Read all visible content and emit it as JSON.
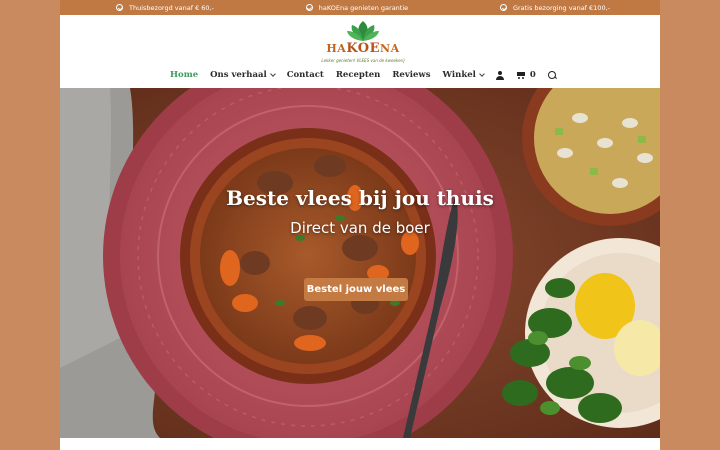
{
  "topbar": {
    "items": [
      {
        "icon": "check-circle-icon",
        "label": "Thuisbezorgd vanaf € 60,-"
      },
      {
        "icon": "check-circle-icon",
        "label": "haKOEna genieten garantie"
      },
      {
        "icon": "check-circle-icon",
        "label": "Gratis bezorging vanaf €100,-"
      }
    ]
  },
  "logo": {
    "prefix": "HA",
    "middle": "KOE",
    "suffix": "NA",
    "tagline": "Lekker genieten! VLEES van de kweekerij"
  },
  "nav": {
    "items": [
      {
        "label": "Home",
        "active": true
      },
      {
        "label": "Ons verhaal",
        "dropdown": true
      },
      {
        "label": "Contact"
      },
      {
        "label": "Recepten"
      },
      {
        "label": "Reviews"
      },
      {
        "label": "Winkel",
        "dropdown": true
      }
    ],
    "cart_count": "0"
  },
  "hero": {
    "title": "Beste vlees bij jou thuis",
    "subtitle": "Direct van de boer",
    "cta_label": "Bestel jouw vlees"
  },
  "colors": {
    "topbar": "#c17944",
    "accent": "#c47a43",
    "active_nav": "#3d9a5a",
    "page_bg": "#c98a5f"
  }
}
